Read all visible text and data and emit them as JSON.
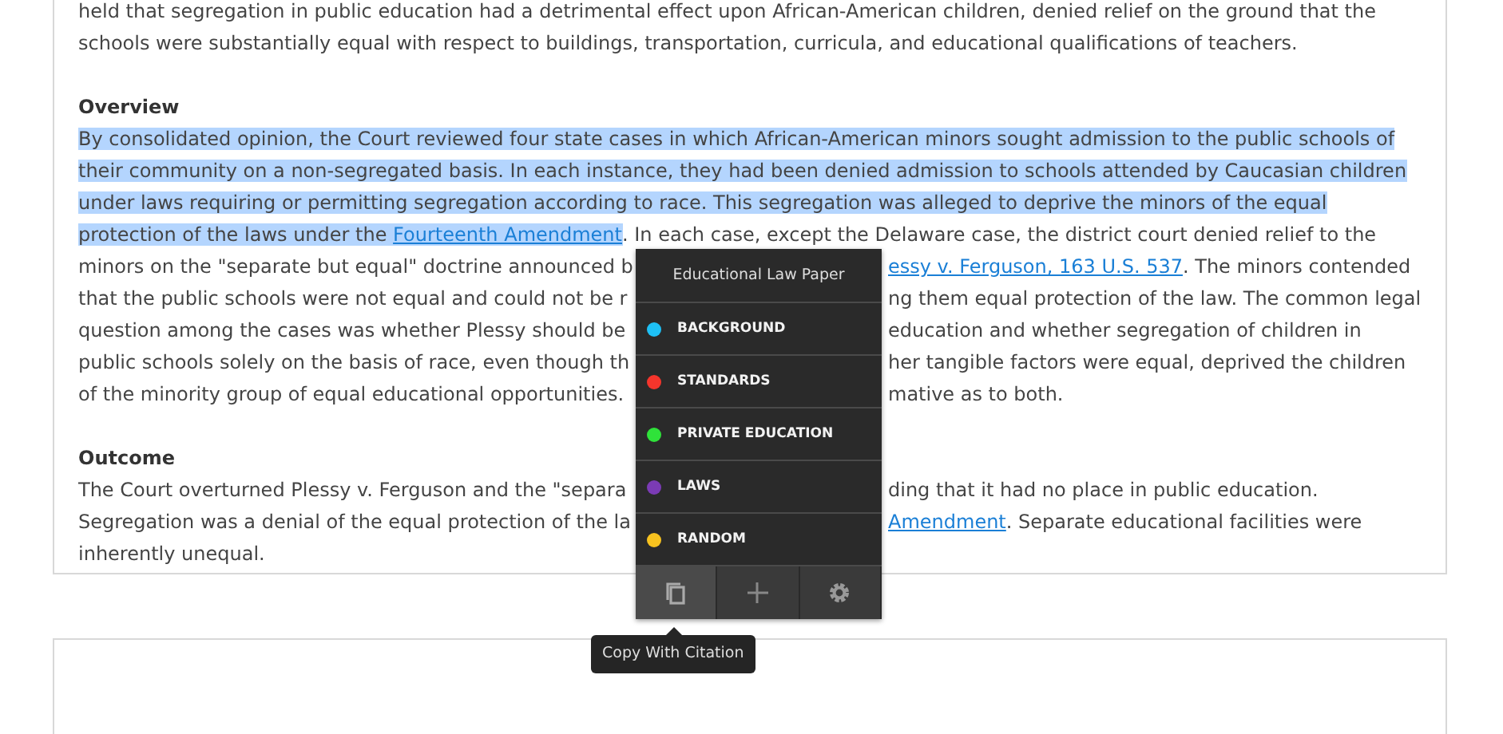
{
  "article": {
    "blocks": [
      {
        "kind": "line",
        "segments": [
          {
            "kind": "text",
            "highlighted": false,
            "text": "held that segregation in public education had a detrimental effect upon African-American children, denied relief on the ground that the"
          }
        ]
      },
      {
        "kind": "line",
        "segments": [
          {
            "kind": "text",
            "highlighted": false,
            "text": "schools were substantially equal with respect to buildings, transportation, curricula, and educational qualifications of teachers."
          }
        ]
      },
      {
        "kind": "blank"
      },
      {
        "kind": "heading",
        "text": "Overview"
      },
      {
        "kind": "line",
        "segments": [
          {
            "kind": "text",
            "highlighted": true,
            "text": "By consolidated opinion, the Court reviewed four state cases in which African-American minors sought admission to the public schools of"
          }
        ]
      },
      {
        "kind": "line",
        "segments": [
          {
            "kind": "text",
            "highlighted": true,
            "text": "their community on a non-segregated basis. In each instance, they had been denied admission to schools attended by Caucasian children"
          }
        ]
      },
      {
        "kind": "line",
        "segments": [
          {
            "kind": "text",
            "highlighted": true,
            "text": "under laws requiring or permitting segregation according to race. This segregation was alleged to deprive the minors of the equal"
          }
        ]
      },
      {
        "kind": "line",
        "segments": [
          {
            "kind": "text",
            "highlighted": true,
            "text": "protection of the laws under the "
          },
          {
            "kind": "link",
            "highlighted": true,
            "text": "Fourteenth Amendment"
          },
          {
            "kind": "text",
            "highlighted": false,
            "text": ". In each case, except the Delaware case, the district court denied relief to the"
          }
        ]
      },
      {
        "kind": "split",
        "segments": [
          {
            "kind": "text",
            "highlighted": false,
            "text": "minors on the \"separate but equal\" doctrine announced b"
          }
        ],
        "after_popup": [
          {
            "kind": "link",
            "highlighted": false,
            "text": "essy v. Ferguson, 163 U.S. 537"
          },
          {
            "kind": "text",
            "highlighted": false,
            "text": ". The minors contended"
          }
        ]
      },
      {
        "kind": "split",
        "segments": [
          {
            "kind": "text",
            "highlighted": false,
            "text": "that the public schools were not equal and could not be r"
          }
        ],
        "after_popup": [
          {
            "kind": "text",
            "highlighted": false,
            "text": "ng them equal protection of the law. The common legal"
          }
        ]
      },
      {
        "kind": "split",
        "segments": [
          {
            "kind": "text",
            "highlighted": false,
            "text": "question among the cases was whether Plessy should be"
          }
        ],
        "after_popup": [
          {
            "kind": "text",
            "highlighted": false,
            "text": "education and whether segregation of children in"
          }
        ]
      },
      {
        "kind": "split",
        "segments": [
          {
            "kind": "text",
            "highlighted": false,
            "text": "public schools solely on the basis of race, even though th"
          }
        ],
        "after_popup": [
          {
            "kind": "text",
            "highlighted": false,
            "text": "her tangible factors were equal, deprived the children"
          }
        ]
      },
      {
        "kind": "split",
        "segments": [
          {
            "kind": "text",
            "highlighted": false,
            "text": "of the minority group of equal educational opportunities."
          }
        ],
        "after_popup": [
          {
            "kind": "text",
            "highlighted": false,
            "text": "mative as to both."
          }
        ]
      },
      {
        "kind": "blank"
      },
      {
        "kind": "heading",
        "text": "Outcome"
      },
      {
        "kind": "split",
        "segments": [
          {
            "kind": "text",
            "highlighted": false,
            "text": "The Court overturned Plessy v. Ferguson and the \"separa"
          }
        ],
        "after_popup": [
          {
            "kind": "text",
            "highlighted": false,
            "text": "ding that it had no place in public education."
          }
        ]
      },
      {
        "kind": "split",
        "segments": [
          {
            "kind": "text",
            "highlighted": false,
            "text": "Segregation was a denial of the equal protection of the la"
          }
        ],
        "after_popup": [
          {
            "kind": "link",
            "highlighted": false,
            "text": "Amendment"
          },
          {
            "kind": "text",
            "highlighted": false,
            "text": ". Separate educational facilities were"
          }
        ]
      },
      {
        "kind": "line",
        "segments": [
          {
            "kind": "text",
            "highlighted": false,
            "text": "inherently unequal."
          }
        ]
      }
    ]
  },
  "popup": {
    "title": "Educational Law Paper",
    "items": [
      {
        "label": "BACKGROUND",
        "color": "#1ec0f5"
      },
      {
        "label": "STANDARDS",
        "color": "#f5352c"
      },
      {
        "label": "PRIVATE EDUCATION",
        "color": "#2fe23a"
      },
      {
        "label": "LAWS",
        "color": "#7b3bb5"
      },
      {
        "label": "RANDOM",
        "color": "#f7c21f"
      }
    ],
    "toolbar": [
      {
        "kind": "copy",
        "selected": true
      },
      {
        "kind": "add",
        "selected": false
      },
      {
        "kind": "settings",
        "selected": false
      }
    ],
    "tooltip": "Copy With Citation"
  }
}
